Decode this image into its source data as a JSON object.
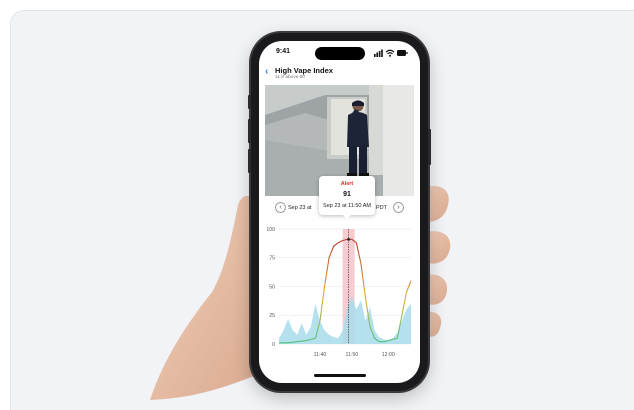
{
  "status_bar": {
    "time": "9:41"
  },
  "header": {
    "title": "High Vape Index",
    "subtitle": "11.8 above 80"
  },
  "tooltip": {
    "title": "Alert",
    "value": "91",
    "time": "Sep 23 at 11:50 AM"
  },
  "date_nav": {
    "date_text": "Sep 23 at",
    "tz_text": "PDT"
  },
  "colors": {
    "alert": "#d93025",
    "line": "#c0392b",
    "area": "#a8dcec",
    "highlight": "#f5c6cc"
  },
  "chart_data": {
    "type": "line",
    "ylim": [
      0,
      100
    ],
    "yticks": [
      "100",
      "75",
      "50",
      "25",
      "0"
    ],
    "xticks": [
      "11:40",
      "11:50",
      "12:00"
    ],
    "alert_marker": {
      "x": "11:50",
      "y": 91
    },
    "series": [
      {
        "values": [
          [
            0,
            1
          ],
          [
            2,
            1
          ],
          [
            4,
            2
          ],
          [
            6,
            3
          ],
          [
            8,
            5
          ],
          [
            9,
            20
          ],
          [
            10,
            50
          ],
          [
            11,
            75
          ],
          [
            12,
            85
          ],
          [
            13,
            88
          ],
          [
            14,
            90
          ],
          [
            15,
            91
          ],
          [
            16,
            91
          ],
          [
            17,
            88
          ],
          [
            18,
            70
          ],
          [
            19,
            40
          ],
          [
            20,
            15
          ],
          [
            21,
            5
          ],
          [
            22,
            2
          ],
          [
            23,
            2
          ],
          [
            24,
            3
          ],
          [
            25,
            4
          ],
          [
            26,
            5
          ],
          [
            27,
            25
          ],
          [
            28,
            45
          ],
          [
            29,
            55
          ]
        ]
      },
      {
        "values": [
          [
            0,
            5
          ],
          [
            1,
            12
          ],
          [
            2,
            22
          ],
          [
            3,
            12
          ],
          [
            4,
            8
          ],
          [
            5,
            18
          ],
          [
            6,
            8
          ],
          [
            7,
            15
          ],
          [
            8,
            35
          ],
          [
            9,
            20
          ],
          [
            10,
            12
          ],
          [
            11,
            8
          ],
          [
            12,
            6
          ],
          [
            13,
            5
          ],
          [
            14,
            12
          ],
          [
            15,
            32
          ],
          [
            16,
            42
          ],
          [
            17,
            30
          ],
          [
            18,
            38
          ],
          [
            19,
            20
          ],
          [
            20,
            32
          ],
          [
            21,
            12
          ],
          [
            22,
            6
          ],
          [
            23,
            4
          ],
          [
            24,
            3
          ],
          [
            25,
            5
          ],
          [
            26,
            10
          ],
          [
            27,
            20
          ],
          [
            28,
            30
          ],
          [
            29,
            35
          ]
        ]
      }
    ]
  }
}
